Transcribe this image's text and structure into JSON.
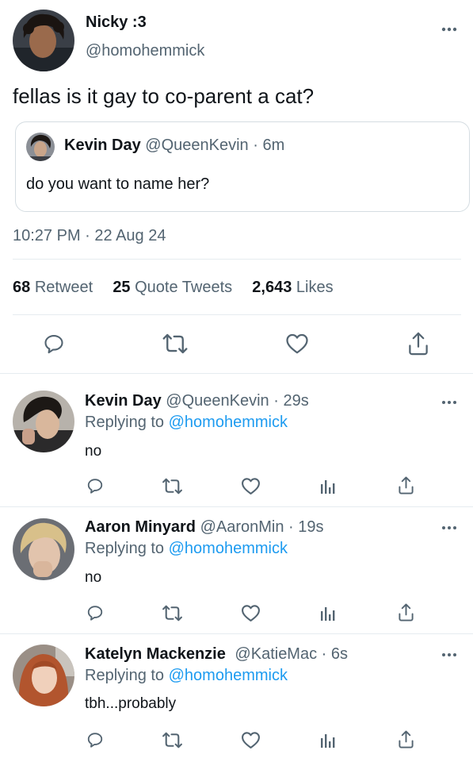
{
  "main_tweet": {
    "author_name": "Nicky :3",
    "author_handle": "@homohemmick",
    "text": "fellas is it gay to co-parent a cat?",
    "quoted": {
      "author_name": "Kevin Day",
      "author_handle": "@QueenKevin",
      "sep": " · ",
      "time": "6m",
      "text": "do you want to name her?"
    },
    "timestamp": "10:27 PM · 22 Aug 24",
    "stats": {
      "retweets": "68",
      "retweets_label": "Retweet",
      "quotes": "25",
      "quotes_label": "Quote Tweets",
      "likes": "2,643",
      "likes_label": "Likes"
    }
  },
  "replies": [
    {
      "author_name": "Kevin Day",
      "author_handle": "@QueenKevin",
      "sep": " · ",
      "time": "29s",
      "replying_to_label": "Replying to",
      "replying_to_handle": "@homohemmick",
      "text": "no"
    },
    {
      "author_name": "Aaron Minyard",
      "author_handle": "@AaronMin",
      "sep": " · ",
      "time": "19s",
      "replying_to_label": "Replying to",
      "replying_to_handle": "@homohemmick",
      "text": "no"
    },
    {
      "author_name": "Katelyn Mackenzie",
      "author_handle": "@KatieMac",
      "sep": " · ",
      "time": "6s",
      "replying_to_label": "Replying to",
      "replying_to_handle": "@homohemmick",
      "text": "tbh...probably"
    }
  ],
  "colors": {
    "text": "#0f1419",
    "secondary": "#536471",
    "link": "#1d9bf0",
    "divider": "#e6ecf0"
  },
  "icons": [
    "reply-icon",
    "retweet-icon",
    "like-icon",
    "analytics-icon",
    "share-icon",
    "more-icon"
  ]
}
